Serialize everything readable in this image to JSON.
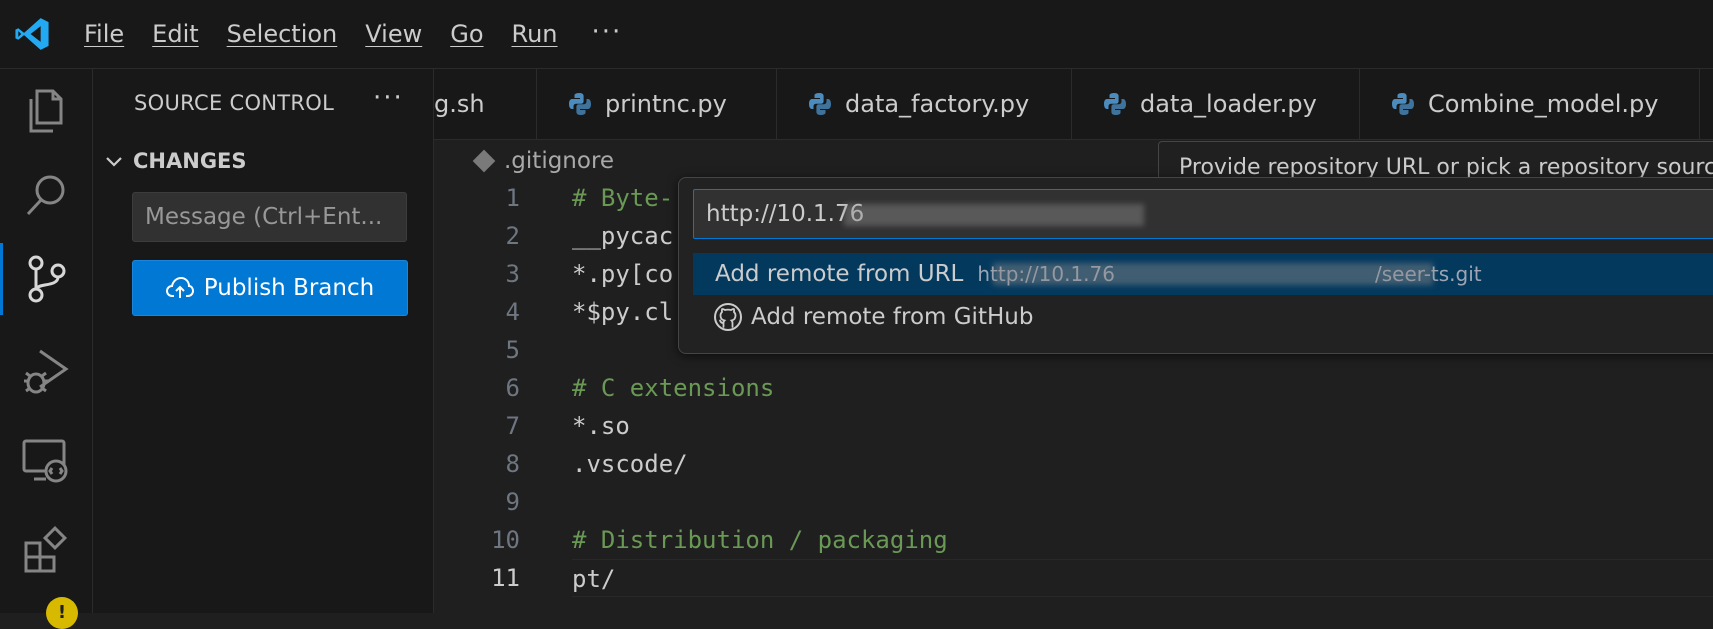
{
  "menu": {
    "items": [
      "File",
      "Edit",
      "Selection",
      "View",
      "Go",
      "Run"
    ],
    "more": "···"
  },
  "sidebar": {
    "title": "SOURCE CONTROL",
    "more": "···",
    "section": "CHANGES",
    "message_placeholder": "Message (Ctrl+Ent...",
    "publish_label": "Publish Branch"
  },
  "tabs": [
    {
      "label": "g.sh"
    },
    {
      "label": "printnc.py",
      "icon": "python-icon"
    },
    {
      "label": "data_factory.py",
      "icon": "python-icon"
    },
    {
      "label": "data_loader.py",
      "icon": "python-icon"
    },
    {
      "label": "Combine_model.py",
      "icon": "python-icon"
    }
  ],
  "breadcrumb": {
    "file": ".gitignore"
  },
  "editor": {
    "line_numbers": [
      "1",
      "2",
      "3",
      "4",
      "5",
      "6",
      "7",
      "8",
      "9",
      "10",
      "11"
    ],
    "lines": [
      "# Byte-",
      "__pycac",
      "*.py[co",
      "*$py.cl",
      "",
      "# C extensions",
      "*.so",
      ".vscode/",
      "",
      "# Distribution / packaging",
      "pt/"
    ],
    "current_line": 11
  },
  "quick_input": {
    "value": "http://10.1.76",
    "options": [
      {
        "label": "Add remote from URL",
        "description": "http://10.1.76",
        "description_tail": "/seer-ts.git"
      },
      {
        "label": "Add remote from GitHub",
        "icon": "github-icon"
      }
    ]
  },
  "tooltip": {
    "text": "Provide repository URL or pick a repository source."
  },
  "colors": {
    "accent": "#0078d4",
    "selection": "#04395e",
    "comment": "#6a9955",
    "warning": "#d7ba00"
  }
}
